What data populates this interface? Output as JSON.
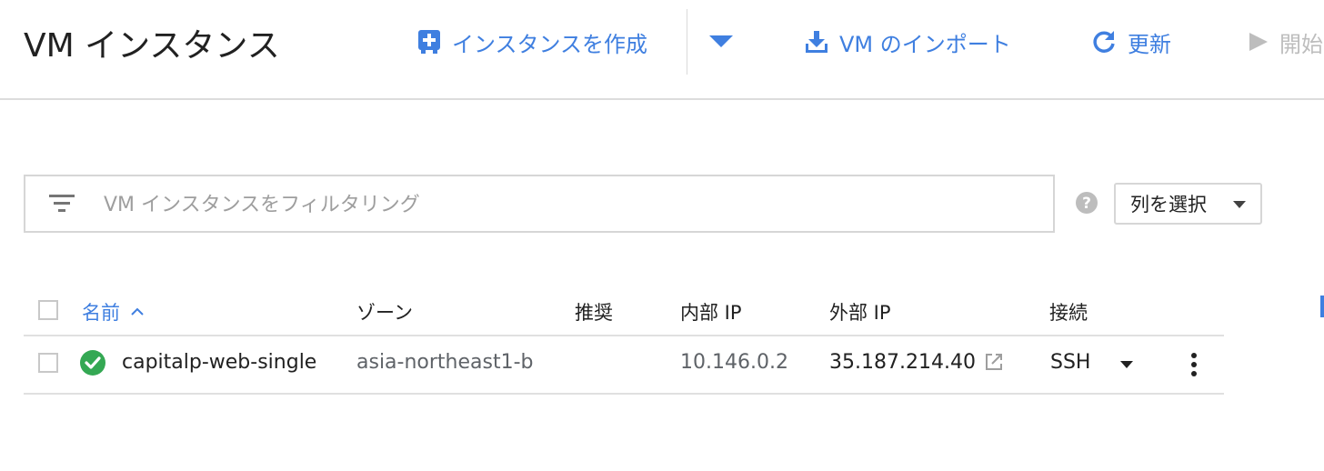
{
  "header": {
    "title": "VM インスタンス",
    "toolbar": {
      "create_label": "インスタンスを作成",
      "import_label": "VM のインポート",
      "refresh_label": "更新",
      "start_label": "開始"
    }
  },
  "filter": {
    "placeholder": "VM インスタンスをフィルタリング",
    "column_select_label": "列を選択"
  },
  "table": {
    "columns": {
      "name": "名前",
      "zone": "ゾーン",
      "recommendation": "推奨",
      "internal_ip": "内部 IP",
      "external_ip": "外部 IP",
      "connect": "接続"
    },
    "rows": [
      {
        "name": "capitalp-web-single",
        "zone": "asia-northeast1-b",
        "recommendation": "",
        "internal_ip": "10.146.0.2",
        "external_ip": "35.187.214.40",
        "connect": "SSH",
        "status_icon": "check-circle-icon",
        "status_color": "#34a853"
      }
    ]
  },
  "colors": {
    "accent": "#3f7fe0",
    "status_ok": "#34a853"
  }
}
